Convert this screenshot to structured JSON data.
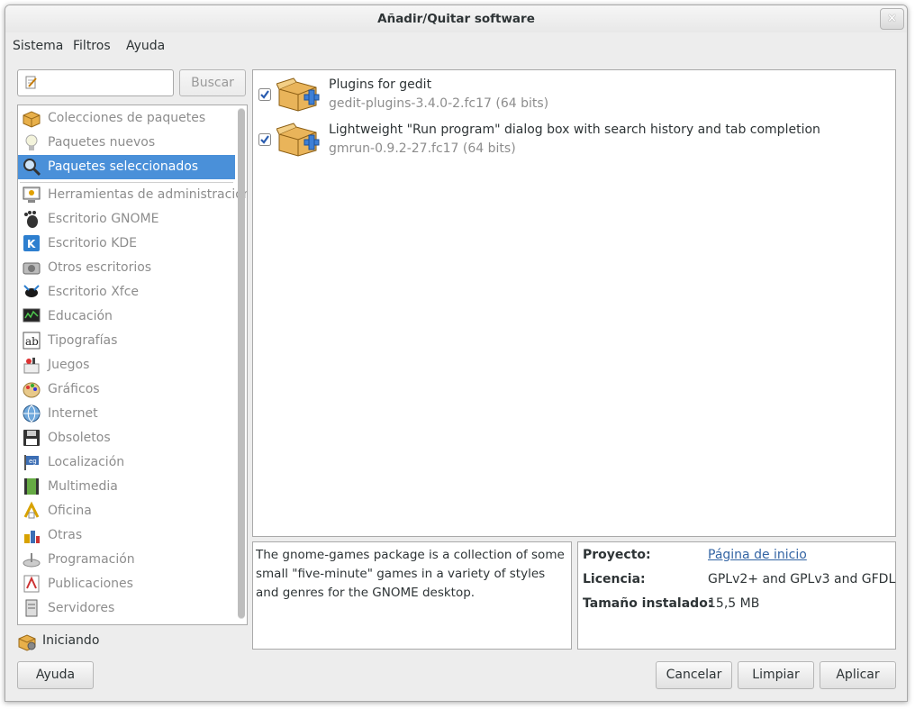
{
  "window": {
    "title": "Añadir/Quitar software",
    "close_label": "×"
  },
  "menu": [
    "Sistema",
    "Filtros",
    "Ayuda"
  ],
  "search": {
    "value": "",
    "placeholder": "",
    "button_label": "Buscar"
  },
  "groups": {
    "special": [
      {
        "label": "Colecciones de paquetes",
        "icon": "package-box-icon"
      },
      {
        "label": "Paquetes nuevos",
        "icon": "lightbulb-icon"
      },
      {
        "label": "Paquetes seleccionados",
        "icon": "magnifier-icon",
        "selected": true
      }
    ],
    "categories": [
      {
        "label": "Herramientas de administración",
        "icon": "admin-tools-icon"
      },
      {
        "label": "Escritorio GNOME",
        "icon": "gnome-foot-icon"
      },
      {
        "label": "Escritorio KDE",
        "icon": "kde-icon"
      },
      {
        "label": "Otros escritorios",
        "icon": "camera-icon"
      },
      {
        "label": "Escritorio Xfce",
        "icon": "xfce-mouse-icon"
      },
      {
        "label": "Educación",
        "icon": "monitor-graph-icon"
      },
      {
        "label": "Tipografías",
        "icon": "font-icon"
      },
      {
        "label": "Juegos",
        "icon": "games-icon"
      },
      {
        "label": "Gráficos",
        "icon": "palette-icon"
      },
      {
        "label": "Internet",
        "icon": "globe-icon"
      },
      {
        "label": "Obsoletos",
        "icon": "floppy-icon"
      },
      {
        "label": "Localización",
        "icon": "flag-icon"
      },
      {
        "label": "Multimedia",
        "icon": "film-icon"
      },
      {
        "label": "Oficina",
        "icon": "office-icon"
      },
      {
        "label": "Otras",
        "icon": "misc-icon"
      },
      {
        "label": "Programación",
        "icon": "programming-icon"
      },
      {
        "label": "Publicaciones",
        "icon": "publishing-icon"
      },
      {
        "label": "Servidores",
        "icon": "server-icon"
      }
    ]
  },
  "packages": [
    {
      "name": "Plugins for gedit",
      "version": "gedit-plugins-3.4.0-2.fc17 (64 bits)",
      "checked": true
    },
    {
      "name": "Lightweight \"Run program\" dialog box with search history and tab completion",
      "version": "gmrun-0.9.2-27.fc17 (64 bits)",
      "checked": true
    }
  ],
  "description": "The gnome-games package is a collection of some small \"five-minute\" games in a variety of styles and genres for the GNOME desktop.",
  "details": {
    "project_label": "Proyecto:",
    "project_value": "Página de inicio",
    "license_label": "Licencia:",
    "license_value": "GPLv2+ and GPLv3 and GFDL",
    "size_label": "Tamaño instalado:",
    "size_value": "15,5 MB"
  },
  "status": {
    "text": "Iniciando"
  },
  "buttons": {
    "help": "Ayuda",
    "cancel": "Cancelar",
    "clear": "Limpiar",
    "apply": "Aplicar"
  },
  "colors": {
    "selection": "#4a90d9",
    "link": "#3465a4",
    "dim_text": "#8d8d8d"
  }
}
